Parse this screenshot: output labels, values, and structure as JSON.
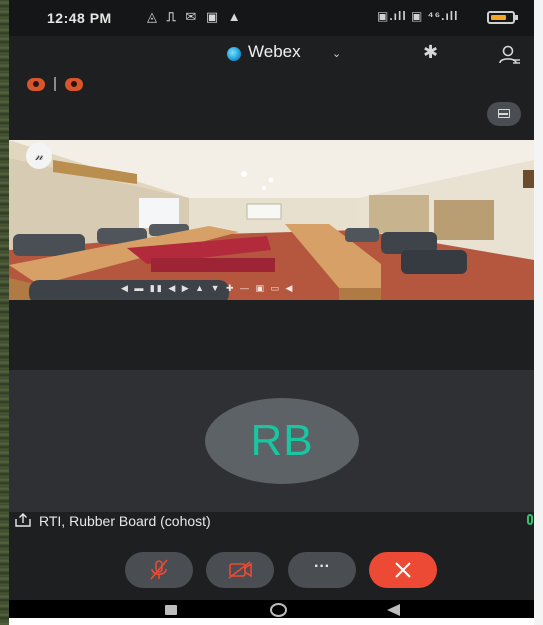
{
  "status_bar": {
    "time": "12:48 PM",
    "notification_glyphs": "◬ ⎍ ✉ ▣ ▲",
    "signal_text": "▣.ıll ▣ ⁴⁶.ıll",
    "battery_percent": 70
  },
  "header": {
    "title": "Webex",
    "dropdown_glyph": "⌄",
    "bluetooth_glyph": "✱"
  },
  "shared_content": {
    "presenter_initial": "𝓃",
    "caption": "",
    "playback_glyphs": "◀ ▬ ▮▮   ◀ ▶ ▲ ▼ ✚ — ▣   ▭ ◀"
  },
  "participant": {
    "initials": "RB",
    "name": "RTI, Rubber Board (cohost)"
  },
  "controls": {
    "more_glyph": "···"
  },
  "colors": {
    "accent_green": "#18c6a2",
    "end_call_red": "#ec4a35",
    "record_orange": "#d9552b",
    "mic_active_green": "#36c26a"
  }
}
